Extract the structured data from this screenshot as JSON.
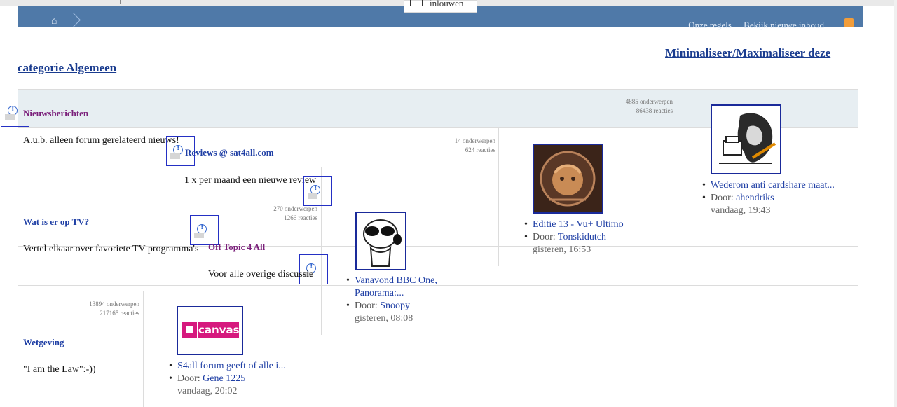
{
  "login": {
    "label": "inlouwen"
  },
  "header": {
    "links": [
      "Onze regels",
      "Bekijk nieuwe inhoud"
    ],
    "rss_icon": "rss-icon",
    "home_icon": "home-icon",
    "bar_color": "#4f79a8"
  },
  "category": {
    "toggle_label": "Minimaliseer/Maximaliseer deze",
    "title": "categorie Algemeen"
  },
  "boards": [
    {
      "title": "Nieuwsberichten",
      "description": "A.u.b. alleen forum gerelateerd nieuws!",
      "topics": "4885 onderwerpen",
      "replies": "86438 reacties",
      "last_post": {
        "title": "Wederom anti cardshare maat...",
        "by_label": "Door:",
        "author": "ahendriks",
        "time": "vandaag, 19:43"
      }
    },
    {
      "title": "Reviews @ sat4all.com",
      "description": "1 x per maand een nieuwe review",
      "topics": "14 onderwerpen",
      "replies": "624 reacties",
      "last_post": {
        "title": "Editie 13 - Vu+ Ultimo",
        "by_label": "Door:",
        "author": "Tonskidutch",
        "time": "gisteren, 16:53"
      }
    },
    {
      "title": "Wat is er op TV?",
      "description": "Vertel elkaar over favoriete TV programma's",
      "topics": "270 onderwerpen",
      "replies": "1266 reacties",
      "last_post": {
        "title": "Vanavond BBC One, Panorama:...",
        "by_label": "Door:",
        "author": "Snoopy",
        "time": "gisteren, 08:08"
      }
    },
    {
      "title": "Off Topic 4 All",
      "description": "Voor alle overige discussie",
      "topics": "",
      "replies": "",
      "last_post": null
    },
    {
      "title": "Wetgeving",
      "description": "\"I am the Law\":-))",
      "topics": "13894 onderwerpen",
      "replies": "217165 reacties",
      "last_post": {
        "title": "S4all forum geeft of alle i...",
        "by_label": "Door:",
        "author": "Gene 1225",
        "time": "vandaag, 20:02"
      }
    }
  ],
  "avatars": {
    "canvas_logo_text": "canvas",
    "canvas_color": "#d6197e"
  }
}
